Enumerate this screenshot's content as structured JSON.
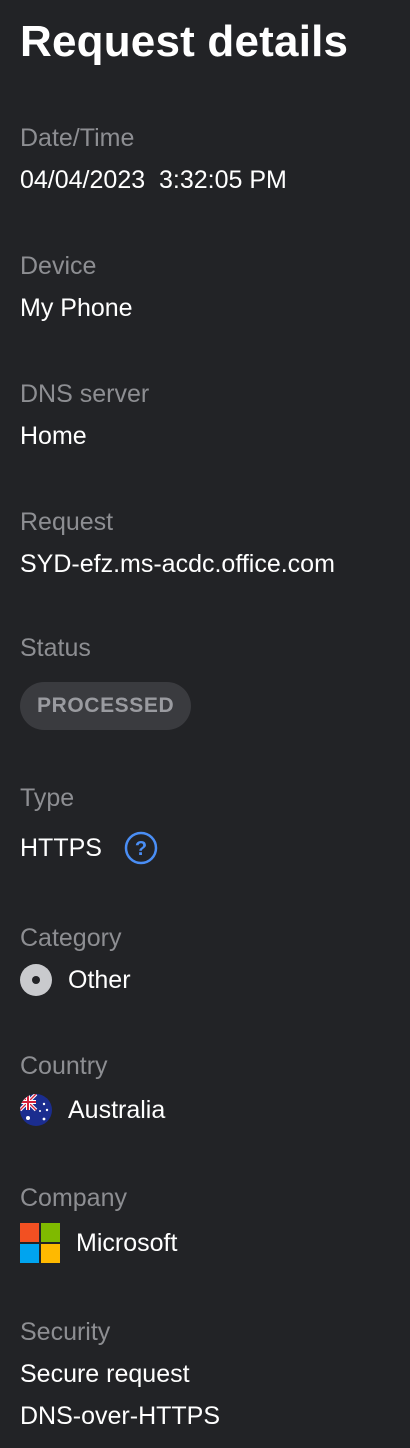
{
  "page": {
    "title": "Request details"
  },
  "fields": {
    "datetime": {
      "label": "Date/Time",
      "value": "04/04/2023  3:32:05 PM"
    },
    "device": {
      "label": "Device",
      "value": "My Phone"
    },
    "dns_server": {
      "label": "DNS server",
      "value": "Home"
    },
    "request": {
      "label": "Request",
      "value": "SYD-efz.ms-acdc.office.com"
    },
    "status": {
      "label": "Status",
      "badge": "PROCESSED"
    },
    "type": {
      "label": "Type",
      "value": "HTTPS",
      "icon": "help-icon"
    },
    "category": {
      "label": "Category",
      "value": "Other",
      "icon": "category-other-icon"
    },
    "country": {
      "label": "Country",
      "value": "Australia",
      "icon": "australia-flag-icon"
    },
    "company": {
      "label": "Company",
      "value": "Microsoft",
      "icon": "microsoft-logo-icon"
    },
    "security": {
      "label": "Security",
      "line1": "Secure request",
      "line2": "DNS-over-HTTPS"
    }
  },
  "colors": {
    "background": "#222326",
    "label": "#8d8e92",
    "value": "#ffffff",
    "badge_bg": "#3a3b3f",
    "badge_text": "#9a9ba0",
    "help_accent": "#4a8ef5",
    "ms_red": "#f25022",
    "ms_green": "#7fba00",
    "ms_blue": "#00a4ef",
    "ms_yellow": "#ffb900"
  }
}
